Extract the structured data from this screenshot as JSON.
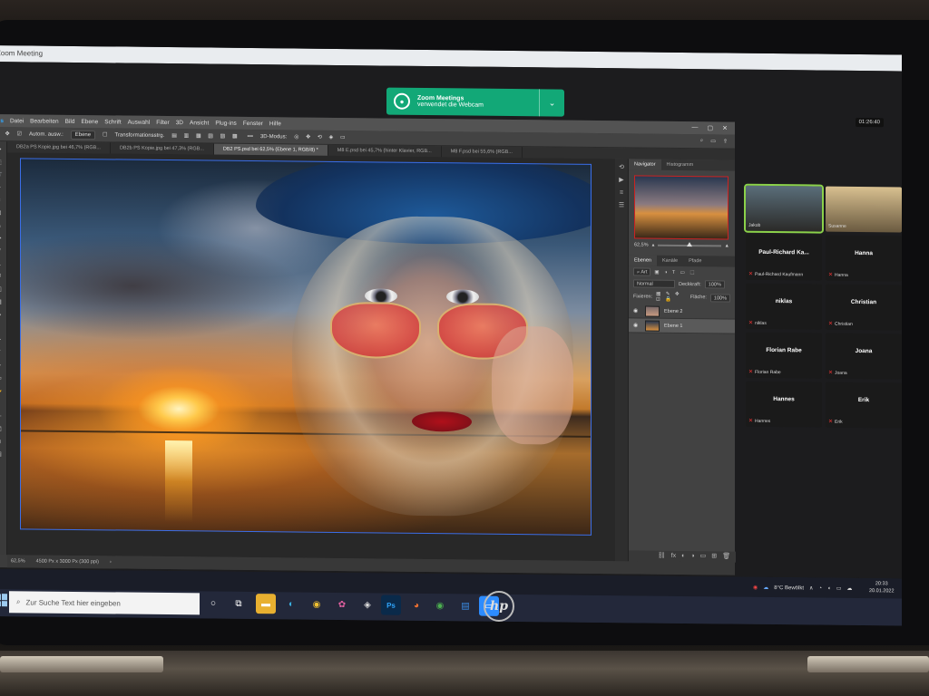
{
  "zoom": {
    "window_title": "Zoom Meeting",
    "toast_line1": "Zoom Meetings",
    "toast_line2": "verwendet die Webcam",
    "timer": "01:26:40",
    "participants": [
      {
        "name": "Paul-Richard  Ka...",
        "label": "Paul-Richard Kaufmann",
        "muted": true
      },
      {
        "name": "Hanna",
        "label": "Hanna",
        "muted": true
      },
      {
        "name": "niklas",
        "label": "niklas",
        "muted": true
      },
      {
        "name": "Christian",
        "label": "Christian",
        "muted": true
      },
      {
        "name": "Florian Rabe",
        "label": "Florian Rabe",
        "muted": true
      },
      {
        "name": "Joana",
        "label": "Joana",
        "muted": true
      },
      {
        "name": "Hannes",
        "label": "Hannes",
        "muted": true
      },
      {
        "name": "Erik",
        "label": "Erik",
        "muted": true
      }
    ],
    "video_tiles": [
      {
        "label": "Jakob"
      },
      {
        "label": "Susanne"
      }
    ]
  },
  "photoshop": {
    "menu": [
      "Datei",
      "Bearbeiten",
      "Bild",
      "Ebene",
      "Schrift",
      "Auswahl",
      "Filter",
      "3D",
      "Ansicht",
      "Plug-ins",
      "Fenster",
      "Hilfe"
    ],
    "options": {
      "auto_select": "Autom. ausw.:",
      "layer_select": "Ebene",
      "transform": "Transformationsstrg.",
      "mode_3d": "3D-Modus:"
    },
    "tabs": [
      {
        "label": "DB2a PS Kopie.jpg bei 46,7% (RGB...",
        "active": false
      },
      {
        "label": "DB2b PS Kopie.jpg bei 47,3% (RGB...",
        "active": false
      },
      {
        "label": "DB2 PS.psd bei 62,5% (Ebene 1, RGB/8) *",
        "active": true
      },
      {
        "label": "M8 E.psd bei 45,7% (hinter Klavier, RGB...",
        "active": false
      },
      {
        "label": "M8 F.psd bei 55,6% (RGB...",
        "active": false
      }
    ],
    "panel_tabs_top": [
      "Navigator",
      "Histogramm"
    ],
    "nav_zoom": "62,5%",
    "panel_tabs_layers": [
      "Ebenen",
      "Kanäle",
      "Pfade"
    ],
    "layer_filter": "Art",
    "blend_mode": "Normal",
    "opacity_label": "Deckkraft:",
    "opacity_value": "100%",
    "lock_label": "Fixieren:",
    "fill_label": "Fläche:",
    "fill_value": "100%",
    "layers": [
      {
        "name": "Ebene 2",
        "selected": false
      },
      {
        "name": "Ebene 1",
        "selected": true
      }
    ],
    "status_zoom": "62,5%",
    "status_dims": "4500 Px x 3000 Px (300 ppi)"
  },
  "taskbar": {
    "search_placeholder": "Zur Suche Text hier eingeben",
    "weather": "8°C  Bewölkt",
    "time": "20:33",
    "date": "20.01.2022"
  },
  "laptop": {
    "brand": "hp"
  }
}
